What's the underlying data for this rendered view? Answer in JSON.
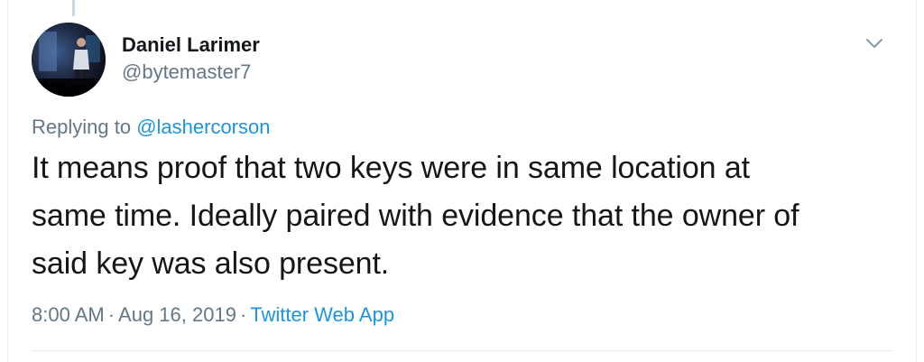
{
  "tweet": {
    "author": {
      "display_name": "Daniel Larimer",
      "handle": "@bytemaster7"
    },
    "reply": {
      "prefix": "Replying to ",
      "target": "@lashercorson"
    },
    "text_lines": [
      "It means proof that two keys were in same location at",
      "same time. Ideally paired with evidence that the owner of",
      "said key was also present."
    ],
    "meta": {
      "time": "8:00 AM",
      "separator": "·",
      "date": "Aug 16, 2019",
      "source": "Twitter Web App"
    },
    "icons": {
      "menu": "chevron-down-icon"
    }
  },
  "colors": {
    "text_primary": "#14171a",
    "text_secondary": "#657786",
    "link": "#1b95e0",
    "border": "#e6ecf0"
  }
}
